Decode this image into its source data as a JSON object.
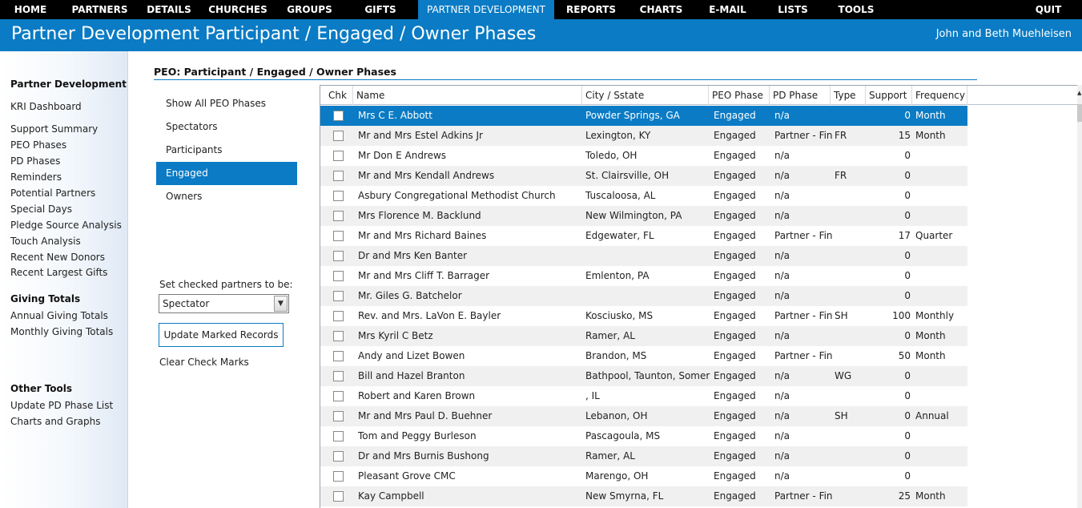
{
  "nav": [
    {
      "label": "HOME"
    },
    {
      "label": "PARTNERS"
    },
    {
      "label": "DETAILS"
    },
    {
      "label": "CHURCHES"
    },
    {
      "label": "GROUPS"
    },
    {
      "label": "GIFTS"
    },
    {
      "label": "PARTNER DEVELOPMENT",
      "active": true
    },
    {
      "label": "REPORTS"
    },
    {
      "label": "CHARTS"
    },
    {
      "label": "E-MAIL"
    },
    {
      "label": "LISTS"
    },
    {
      "label": "TOOLS"
    },
    {
      "label": "QUIT"
    }
  ],
  "header": {
    "title": "Partner Development Participant / Engaged / Owner Phases",
    "user": "John and Beth Muehleisen"
  },
  "sidebar": {
    "partner_dev_heading": "Partner Development",
    "kri": "KRI Dashboard",
    "pd_links": [
      "Support Summary",
      "PEO Phases",
      "PD Phases",
      "Reminders",
      "Potential Partners",
      "Special Days",
      "Pledge Source Analysis",
      "Touch Analysis",
      "Recent New Donors",
      "Recent Largest Gifts"
    ],
    "giving_heading": "Giving Totals",
    "giving_links": [
      "Annual Giving Totals",
      "Monthly Giving Totals"
    ],
    "other_heading": "Other Tools",
    "other_links": [
      "Update PD Phase List",
      "Charts and Graphs"
    ]
  },
  "main": {
    "section_title": "PEO: Participant / Engaged / Owner Phases",
    "phases": [
      "Show All PEO Phases",
      "Spectators",
      "Participants",
      "Engaged",
      "Owners"
    ],
    "active_phase": "Engaged",
    "set_label": "Set checked partners to be:",
    "select_value": "Spectator",
    "update_button": "Update Marked Records",
    "clear_link": "Clear Check Marks"
  },
  "colors": {
    "accent": "#0a7bc4",
    "nav_bg": "#000000",
    "row_alt": "#f0f0f0"
  },
  "grid": {
    "columns": [
      "Chk",
      "Name",
      "City / Sstate",
      "PEO Phase",
      "PD Phase",
      "Type",
      "Support",
      "Frequency"
    ],
    "rows": [
      {
        "name": "Mrs C E. Abbott",
        "city": "Powder Springs, GA",
        "peo": "Engaged",
        "pd": "n/a",
        "type": "",
        "support": "0",
        "freq": "Month",
        "selected": true
      },
      {
        "name": "Mr and Mrs Estel Adkins Jr",
        "city": "Lexington, KY",
        "peo": "Engaged",
        "pd": "Partner - Fina",
        "type": "FR",
        "support": "15",
        "freq": "Month"
      },
      {
        "name": "Mr Don E Andrews",
        "city": "Toledo, OH",
        "peo": "Engaged",
        "pd": "n/a",
        "type": "",
        "support": "0",
        "freq": ""
      },
      {
        "name": "Mr and Mrs Kendall Andrews",
        "city": "St. Clairsville, OH",
        "peo": "Engaged",
        "pd": "n/a",
        "type": "FR",
        "support": "0",
        "freq": ""
      },
      {
        "name": "Asbury Congregational Methodist Church",
        "city": "Tuscaloosa, AL",
        "peo": "Engaged",
        "pd": "n/a",
        "type": "",
        "support": "0",
        "freq": ""
      },
      {
        "name": "Mrs Florence M. Backlund",
        "city": "New Wilmington, PA",
        "peo": "Engaged",
        "pd": "n/a",
        "type": "",
        "support": "0",
        "freq": ""
      },
      {
        "name": "Mr and Mrs Richard Baines",
        "city": "Edgewater, FL",
        "peo": "Engaged",
        "pd": "Partner - Fina",
        "type": "",
        "support": "17",
        "freq": "Quarter"
      },
      {
        "name": "Dr and Mrs Ken Banter",
        "city": "",
        "peo": "Engaged",
        "pd": "n/a",
        "type": "",
        "support": "0",
        "freq": ""
      },
      {
        "name": "Mr and Mrs Cliff T. Barrager",
        "city": "Emlenton, PA",
        "peo": "Engaged",
        "pd": "n/a",
        "type": "",
        "support": "0",
        "freq": ""
      },
      {
        "name": "Mr. Giles G. Batchelor",
        "city": "",
        "peo": "Engaged",
        "pd": "n/a",
        "type": "",
        "support": "0",
        "freq": ""
      },
      {
        "name": "Rev. and Mrs. LaVon E. Bayler",
        "city": "Kosciusko, MS",
        "peo": "Engaged",
        "pd": "Partner - Fina",
        "type": "SH",
        "support": "100",
        "freq": "Monthly"
      },
      {
        "name": "Mrs Kyril C Betz",
        "city": "Ramer, AL",
        "peo": "Engaged",
        "pd": "n/a",
        "type": "",
        "support": "0",
        "freq": "Month"
      },
      {
        "name": "Andy and Lizet Bowen",
        "city": "Brandon, MS",
        "peo": "Engaged",
        "pd": "Partner - Fina",
        "type": "",
        "support": "50",
        "freq": "Month"
      },
      {
        "name": "Bill and Hazel Branton",
        "city": "Bathpool, Taunton, Somerset",
        "peo": "Engaged",
        "pd": "n/a",
        "type": "WG",
        "support": "0",
        "freq": ""
      },
      {
        "name": "Robert and Karen Brown",
        "city": ", IL",
        "peo": "Engaged",
        "pd": "n/a",
        "type": "",
        "support": "0",
        "freq": ""
      },
      {
        "name": "Mr and Mrs Paul D. Buehner",
        "city": "Lebanon, OH",
        "peo": "Engaged",
        "pd": "n/a",
        "type": "SH",
        "support": "0",
        "freq": "Annual"
      },
      {
        "name": "Tom and Peggy Burleson",
        "city": "Pascagoula, MS",
        "peo": "Engaged",
        "pd": "n/a",
        "type": "",
        "support": "0",
        "freq": ""
      },
      {
        "name": "Dr and Mrs Burnis Bushong",
        "city": "Ramer, AL",
        "peo": "Engaged",
        "pd": "n/a",
        "type": "",
        "support": "0",
        "freq": ""
      },
      {
        "name": "Pleasant Grove CMC",
        "city": "Marengo, OH",
        "peo": "Engaged",
        "pd": "n/a",
        "type": "",
        "support": "0",
        "freq": ""
      },
      {
        "name": "Kay Campbell",
        "city": "New Smyrna, FL",
        "peo": "Engaged",
        "pd": "Partner - Fina",
        "type": "",
        "support": "25",
        "freq": "Month"
      }
    ]
  }
}
